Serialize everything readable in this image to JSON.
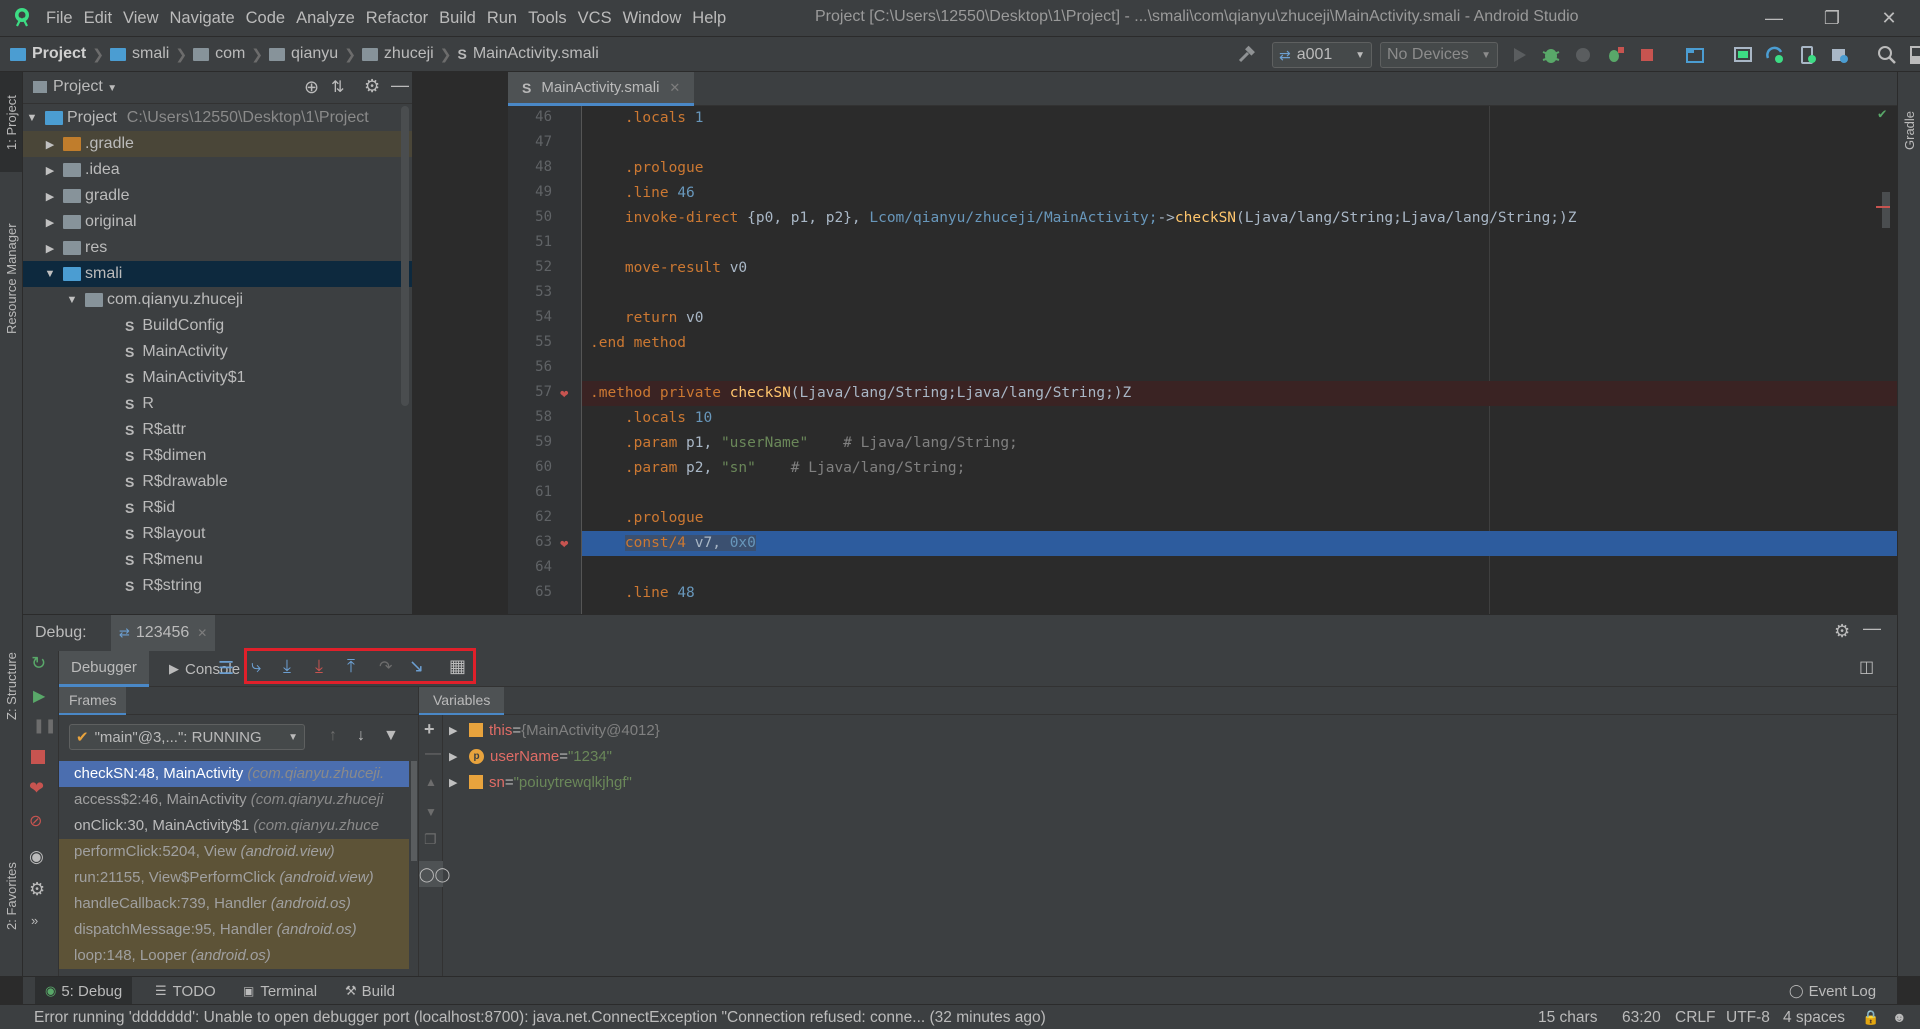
{
  "menubar": {
    "items": [
      "File",
      "Edit",
      "View",
      "Navigate",
      "Code",
      "Analyze",
      "Refactor",
      "Build",
      "Run",
      "Tools",
      "VCS",
      "Window",
      "Help"
    ],
    "window_title": "Project [C:\\Users\\12550\\Desktop\\1\\Project] - ...\\smali\\com\\qianyu\\zhuceji\\MainActivity.smali - Android Studio"
  },
  "navbar": {
    "crumbs": [
      "Project",
      "smali",
      "com",
      "qianyu",
      "zhuceji",
      "MainActivity.smali"
    ],
    "device_config": "a001",
    "devices": "No Devices"
  },
  "stripes": {
    "left_top": "1: Project",
    "left_mid": "Resource Manager",
    "left_structure": "Z: Structure",
    "left_favorites": "2: Favorites",
    "right_gradle": "Gradle"
  },
  "project_panel": {
    "title": "Project",
    "tree": [
      {
        "label": "Project",
        "extra": "C:\\Users\\12550\\Desktop\\1\\Project"
      },
      {
        "label": ".gradle"
      },
      {
        "label": ".idea"
      },
      {
        "label": "gradle"
      },
      {
        "label": "original"
      },
      {
        "label": "res"
      },
      {
        "label": "smali"
      },
      {
        "label": "com.qianyu.zhuceji"
      },
      {
        "label": "BuildConfig"
      },
      {
        "label": "MainActivity"
      },
      {
        "label": "MainActivity$1"
      },
      {
        "label": "R"
      },
      {
        "label": "R$attr"
      },
      {
        "label": "R$dimen"
      },
      {
        "label": "R$drawable"
      },
      {
        "label": "R$id"
      },
      {
        "label": "R$layout"
      },
      {
        "label": "R$menu"
      },
      {
        "label": "R$string"
      }
    ]
  },
  "editor": {
    "tab_label": "MainActivity.smali",
    "line_numbers": [
      "46",
      "47",
      "48",
      "49",
      "50",
      "51",
      "52",
      "53",
      "54",
      "55",
      "56",
      "57",
      "58",
      "59",
      "60",
      "61",
      "62",
      "63",
      "64",
      "65"
    ],
    "lines": {
      "l46": [
        ".locals ",
        "1"
      ],
      "l48": ".prologue",
      "l49": [
        ".line ",
        "46"
      ],
      "l50": [
        "invoke-direct ",
        "{p0, p1, p2}, ",
        "Lcom/qianyu/zhuceji/MainActivity;",
        "->",
        "checkSN",
        "(Ljava/lang/String;Ljava/lang/String;)Z"
      ],
      "l52": [
        "move-result ",
        "v0"
      ],
      "l54": [
        "return ",
        "v0"
      ],
      "l55": ".end method",
      "l57": [
        ".method private ",
        "checkSN",
        "(Ljava/lang/String;Ljava/lang/String;)Z"
      ],
      "l58": [
        ".locals ",
        "10"
      ],
      "l59": [
        ".param ",
        "p1, ",
        "\"userName\"",
        "    # Ljava/lang/String;"
      ],
      "l60": [
        ".param ",
        "p2, ",
        "\"sn\"",
        "    # Ljava/lang/String;"
      ],
      "l62": ".prologue",
      "l63": [
        "const/4 ",
        "v7, ",
        "0x0"
      ],
      "l65": [
        ".line ",
        "48"
      ]
    }
  },
  "debug": {
    "label": "Debug:",
    "session": "123456",
    "tabs": {
      "debugger": "Debugger",
      "console": "Console"
    },
    "frames_tab": "Frames",
    "variables_tab": "Variables",
    "thread": "\"main\"@3,...\": RUNNING",
    "frames": [
      {
        "method": "checkSN:48, MainActivity ",
        "pkg": "(com.qianyu.zhuceji."
      },
      {
        "method": "access$2:46, MainActivity ",
        "pkg": "(com.qianyu.zhuceji"
      },
      {
        "method": "onClick:30, MainActivity$1 ",
        "pkg": "(com.qianyu.zhuce"
      },
      {
        "method": "performClick:5204, View ",
        "pkg": "(android.view)"
      },
      {
        "method": "run:21155, View$PerformClick ",
        "pkg": "(android.view)"
      },
      {
        "method": "handleCallback:739, Handler ",
        "pkg": "(android.os)"
      },
      {
        "method": "dispatchMessage:95, Handler ",
        "pkg": "(android.os)"
      },
      {
        "method": "loop:148, Looper ",
        "pkg": "(android.os)"
      }
    ],
    "variables": [
      {
        "name": "this",
        "eq": " = ",
        "value": "{MainActivity@4012}"
      },
      {
        "name": "userName",
        "eq": " = ",
        "value": "\"1234\""
      },
      {
        "name": "sn",
        "eq": " = ",
        "value": "\"poiuytrewqlkjhgf\""
      }
    ]
  },
  "bottom_tabs": {
    "debug": "5: Debug",
    "todo": "TODO",
    "terminal": "Terminal",
    "build": "Build",
    "event_log": "Event Log"
  },
  "statusbar": {
    "message": "Error running 'ddddddd': Unable to open debugger port (localhost:8700): java.net.ConnectException \"Connection refused: conne... (32 minutes ago)",
    "chars": "15 chars",
    "position": "63:20",
    "line_sep": "CRLF",
    "encoding": "UTF-8",
    "indent": "4 spaces"
  },
  "colors": {
    "accent_blue": "#4a88c7",
    "breakpoint_red": "#c75450",
    "exec_line": "#2d5c9e",
    "highlight_box": "#e0202a"
  }
}
